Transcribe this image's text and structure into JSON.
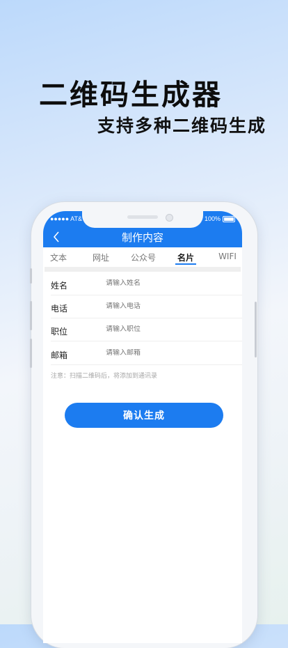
{
  "hero": {
    "title": "二维码生成器",
    "subtitle": "支持多种二维码生成"
  },
  "status_bar": {
    "carrier": "●●●●● AT&T",
    "battery": "100%"
  },
  "nav": {
    "title": "制作内容",
    "back_icon": "chevron-left-icon"
  },
  "tabs": [
    {
      "label": "文本",
      "active": false
    },
    {
      "label": "网址",
      "active": false
    },
    {
      "label": "公众号",
      "active": false
    },
    {
      "label": "名片",
      "active": true
    },
    {
      "label": "WIFI",
      "active": false
    }
  ],
  "form": {
    "fields": [
      {
        "label": "姓名",
        "placeholder": "请输入姓名"
      },
      {
        "label": "电话",
        "placeholder": "请输入电话"
      },
      {
        "label": "职位",
        "placeholder": "请输入职位"
      },
      {
        "label": "邮箱",
        "placeholder": "请输入邮箱"
      }
    ],
    "note": "注意：扫描二维码后，将添加到通讯录"
  },
  "confirm_button": "确认生成",
  "colors": {
    "accent": "#1c7cf0"
  }
}
